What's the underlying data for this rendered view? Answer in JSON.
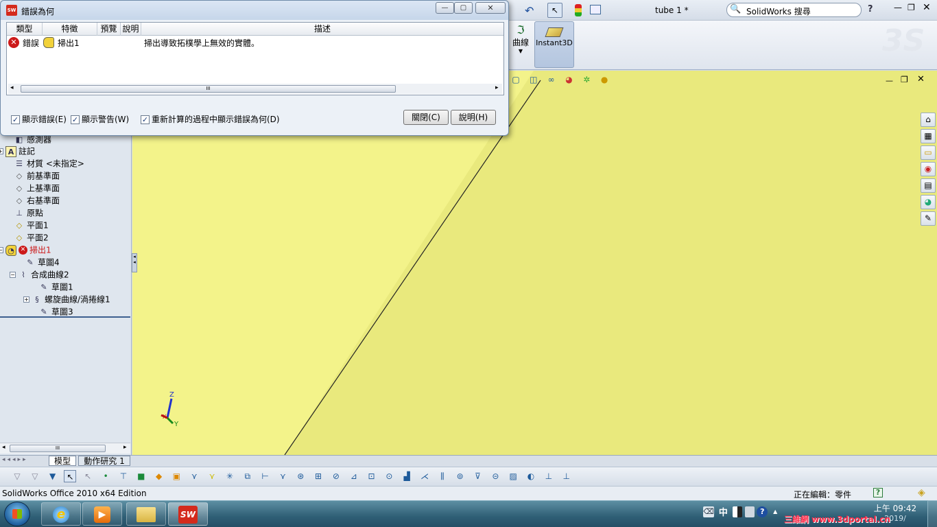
{
  "window": {
    "doc_title": "tube 1 *",
    "search_label": "SolidWorks 搜尋",
    "help": "?"
  },
  "command_manager": {
    "curve_label": "曲線",
    "instant3d_label": "Instant3D"
  },
  "dialog": {
    "title": "錯誤為何",
    "columns": [
      "類型",
      "特徵",
      "預覽",
      "說明",
      "描述"
    ],
    "rows": [
      {
        "type": "錯誤",
        "feature": "掃出1",
        "preview": "",
        "explanation": "",
        "description": "掃出導致拓樸學上無效的實體。"
      }
    ],
    "scroll_grip": "III",
    "show_errors": "顯示錯誤(E)",
    "show_warnings": "顯示警告(W)",
    "show_on_rebuild": "重新計算的過程中顯示錯誤為何(D)",
    "close_button": "關閉(C)",
    "help_button": "說明(H)"
  },
  "feature_tree": {
    "items": [
      {
        "label": "感測器",
        "icon": "sensor-icon"
      },
      {
        "label": "註記",
        "icon": "annotation-icon"
      },
      {
        "label": "材質 <未指定>",
        "icon": "material-icon"
      },
      {
        "label": "前基準面",
        "icon": "plane-icon"
      },
      {
        "label": "上基準面",
        "icon": "plane-icon"
      },
      {
        "label": "右基準面",
        "icon": "plane-icon"
      },
      {
        "label": "原點",
        "icon": "origin-icon"
      },
      {
        "label": "平面1",
        "icon": "plane-icon"
      },
      {
        "label": "平面2",
        "icon": "plane-icon"
      },
      {
        "label": "掃出1",
        "icon": "sweep-icon",
        "error": true
      },
      {
        "label": "草圖4",
        "icon": "sketch-icon"
      },
      {
        "label": "合成曲線2",
        "icon": "composite-curve-icon"
      },
      {
        "label": "草圖1",
        "icon": "sketch-icon"
      },
      {
        "label": "螺旋曲線/渦捲線1",
        "icon": "helix-icon"
      },
      {
        "label": "草圖3",
        "icon": "sketch-icon"
      }
    ],
    "hscroll_grip": "III"
  },
  "bottom_tabs": {
    "model": "模型",
    "motion": "動作研究 1"
  },
  "triad": {
    "z": "Z",
    "y": "Y",
    "x": "X"
  },
  "status": {
    "edition": "SolidWorks Office 2010 x64 Edition",
    "editing": "正在編輯：零件",
    "help": "?"
  },
  "taskbar": {
    "ime": "中",
    "time": "上午 09:42",
    "date": "2019/",
    "watermark": "三維網 www.3dportal.cn"
  },
  "colors": {
    "viewport": "#f3f38a",
    "viewport_right": "#e9e97d",
    "error_red": "#cc1a1a",
    "taskbar": "#2f5f76"
  }
}
